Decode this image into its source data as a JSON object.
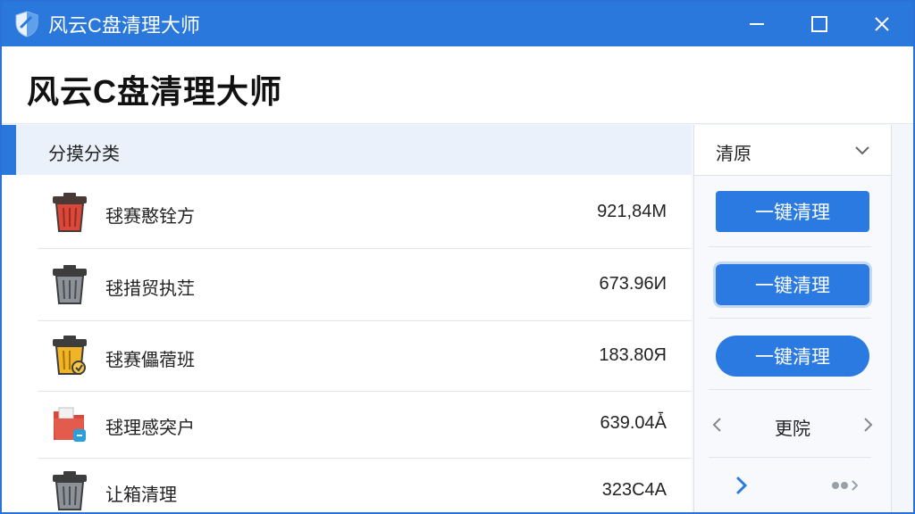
{
  "window": {
    "title": "风云C盘清理大师"
  },
  "header": {
    "app_title": "风云C盘清理大师"
  },
  "category": {
    "label": "分摸分类"
  },
  "rows": [
    {
      "icon": "trash-red-icon",
      "label": "毬赛憨铨方",
      "size": "921,84M"
    },
    {
      "icon": "trash-gray-icon",
      "label": "毬措贸执茳",
      "size": "673.96И"
    },
    {
      "icon": "trash-yellow-icon",
      "label": "毬赛儡蓿班",
      "size": "183.80Я"
    },
    {
      "icon": "folder-red-icon",
      "label": "毬理感突户",
      "size": "639.04Ǡ"
    },
    {
      "icon": "trash-gray-icon",
      "label": "让箱清理",
      "size": "323C4A"
    }
  ],
  "sidebar": {
    "dropdown_label": "清原",
    "clean_button_label": "一键清理",
    "pager_label": "更院"
  },
  "colors": {
    "accent": "#2a78dc",
    "button": "#2a7ae2"
  }
}
